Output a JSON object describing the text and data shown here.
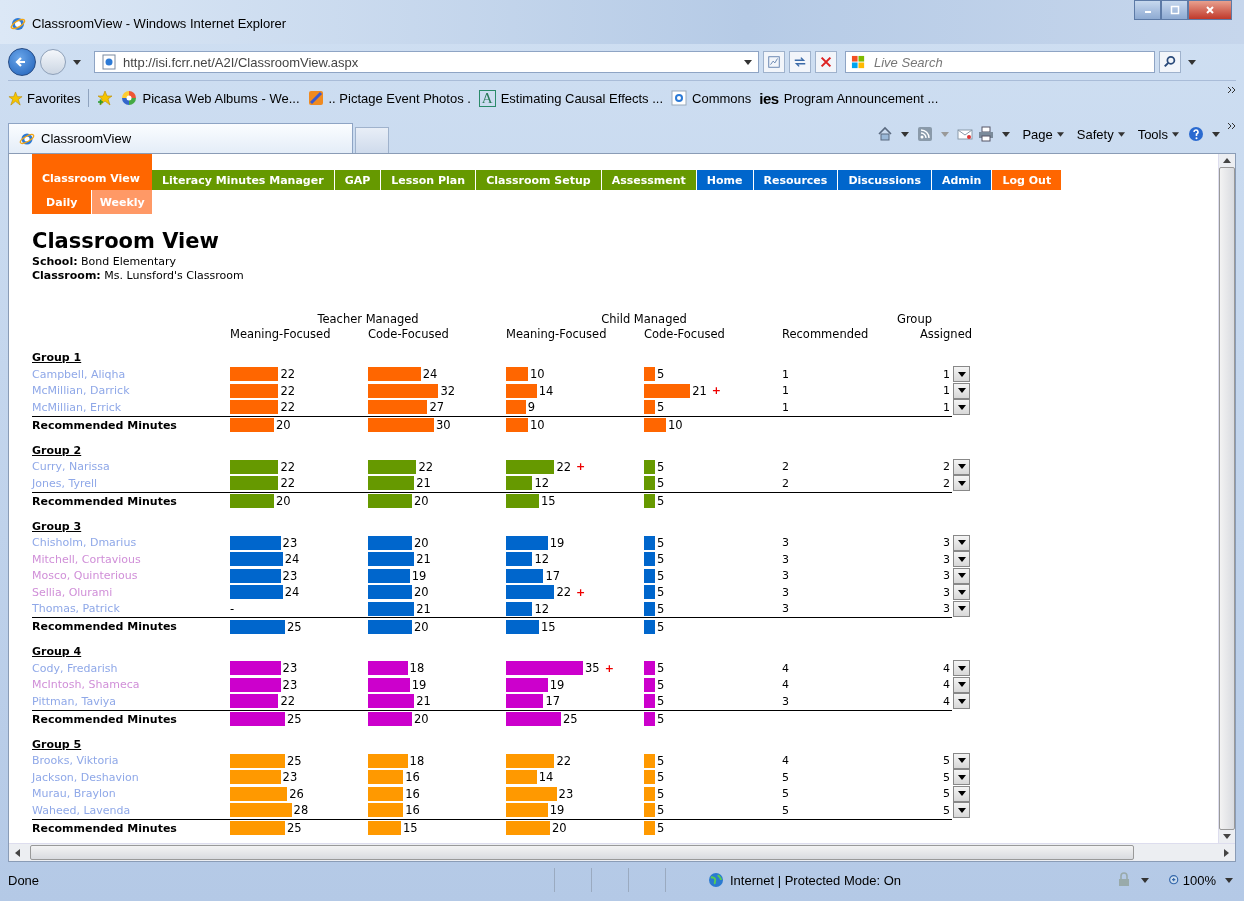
{
  "window": {
    "title": "ClassroomView - Windows Internet Explorer"
  },
  "address_bar": {
    "url": "http://isi.fcrr.net/A2I/ClassroomView.aspx"
  },
  "search": {
    "placeholder": "Live Search"
  },
  "favorites_bar": {
    "label": "Favorites",
    "items": [
      {
        "label": "Picasa Web Albums - We..."
      },
      {
        "label": ".. Pictage  Event Photos ."
      },
      {
        "label": "Estimating Causal Effects ...",
        "icon_text": "A"
      },
      {
        "label": "Commons"
      },
      {
        "label": "Program Announcement ...",
        "icon_text": "ies"
      }
    ]
  },
  "browser_tab": {
    "title": "ClassroomView"
  },
  "command_bar": [
    "Page",
    "Safety",
    "Tools"
  ],
  "nav": {
    "tabs": [
      {
        "label": "Classroom View",
        "color": "#ff6600",
        "selected": true
      },
      {
        "label": "Literacy Minutes Manager",
        "color": "#669900",
        "selected": false
      },
      {
        "label": "GAP",
        "color": "#669900",
        "selected": false
      },
      {
        "label": "Lesson Plan",
        "color": "#669900",
        "selected": false
      },
      {
        "label": "Classroom Setup",
        "color": "#669900",
        "selected": false
      },
      {
        "label": "Assessment",
        "color": "#669900",
        "selected": false
      },
      {
        "label": "Home",
        "color": "#0066cc",
        "selected": false
      },
      {
        "label": "Resources",
        "color": "#0066cc",
        "selected": false
      },
      {
        "label": "Discussions",
        "color": "#0066cc",
        "selected": false
      },
      {
        "label": "Admin",
        "color": "#0066cc",
        "selected": false
      },
      {
        "label": "Log Out",
        "color": "#ff6600",
        "selected": false
      }
    ],
    "subtabs": [
      {
        "label": "Daily",
        "selected": true
      },
      {
        "label": "Weekly",
        "selected": false
      }
    ]
  },
  "page": {
    "title": "Classroom View",
    "school_label": "School:",
    "school": "Bond Elementary",
    "classroom_label": "Classroom:",
    "classroom": "Ms. Lunsford's Classroom"
  },
  "table": {
    "header_groups": [
      "Teacher Managed",
      "Child Managed",
      "Group"
    ],
    "columns": [
      "Meaning-Focused",
      "Code-Focused",
      "Meaning-Focused",
      "Code-Focused",
      "Recommended",
      "Assigned"
    ],
    "groups": [
      {
        "name": "Group 1",
        "color": "#ff6600",
        "students": [
          {
            "name": "Campbell, Aliqha",
            "color": "#8fa8e8",
            "minutes": [
              {
                "value": "22"
              },
              {
                "value": "24"
              },
              {
                "value": "10"
              },
              {
                "value": "5"
              }
            ],
            "recommended": "1",
            "assigned": "1"
          },
          {
            "name": "McMillian, Darrick",
            "color": "#8fa8e8",
            "minutes": [
              {
                "value": "22"
              },
              {
                "value": "32"
              },
              {
                "value": "14"
              },
              {
                "value": "21",
                "flag": "+"
              }
            ],
            "recommended": "1",
            "assigned": "1"
          },
          {
            "name": "McMillian, Errick",
            "color": "#8fa8e8",
            "minutes": [
              {
                "value": "22"
              },
              {
                "value": "27"
              },
              {
                "value": "9"
              },
              {
                "value": "5"
              }
            ],
            "recommended": "1",
            "assigned": "1"
          }
        ],
        "recommended_minutes": {
          "label": "Recommended Minutes",
          "minutes": [
            {
              "value": "20"
            },
            {
              "value": "30"
            },
            {
              "value": "10"
            },
            {
              "value": "10"
            }
          ]
        }
      },
      {
        "name": "Group 2",
        "color": "#669900",
        "students": [
          {
            "name": "Curry, Narissa",
            "color": "#8fa8e8",
            "minutes": [
              {
                "value": "22"
              },
              {
                "value": "22"
              },
              {
                "value": "22",
                "flag": "+"
              },
              {
                "value": "5"
              }
            ],
            "recommended": "2",
            "assigned": "2"
          },
          {
            "name": "Jones, Tyrell",
            "color": "#8fa8e8",
            "minutes": [
              {
                "value": "22"
              },
              {
                "value": "21"
              },
              {
                "value": "12"
              },
              {
                "value": "5"
              }
            ],
            "recommended": "2",
            "assigned": "2"
          }
        ],
        "recommended_minutes": {
          "label": "Recommended Minutes",
          "minutes": [
            {
              "value": "20"
            },
            {
              "value": "20"
            },
            {
              "value": "15"
            },
            {
              "value": "5"
            }
          ]
        }
      },
      {
        "name": "Group 3",
        "color": "#0066cc",
        "students": [
          {
            "name": "Chisholm, Dmarius",
            "color": "#8fa8e8",
            "minutes": [
              {
                "value": "23"
              },
              {
                "value": "20"
              },
              {
                "value": "19"
              },
              {
                "value": "5"
              }
            ],
            "recommended": "3",
            "assigned": "3"
          },
          {
            "name": "Mitchell, Cortavious",
            "color": "#d08fd8",
            "minutes": [
              {
                "value": "24"
              },
              {
                "value": "21"
              },
              {
                "value": "12"
              },
              {
                "value": "5"
              }
            ],
            "recommended": "3",
            "assigned": "3"
          },
          {
            "name": "Mosco, Quinterious",
            "color": "#d08fd8",
            "minutes": [
              {
                "value": "23"
              },
              {
                "value": "19"
              },
              {
                "value": "17"
              },
              {
                "value": "5"
              }
            ],
            "recommended": "3",
            "assigned": "3"
          },
          {
            "name": "Sellia, Olurami",
            "color": "#d08fd8",
            "minutes": [
              {
                "value": "24"
              },
              {
                "value": "20"
              },
              {
                "value": "22",
                "flag": "+"
              },
              {
                "value": "5"
              }
            ],
            "recommended": "3",
            "assigned": "3"
          },
          {
            "name": "Thomas, Patrick",
            "color": "#8fa8e8",
            "minutes": [
              {
                "value": "-"
              },
              {
                "value": "21"
              },
              {
                "value": "12"
              },
              {
                "value": "5"
              }
            ],
            "recommended": "3",
            "assigned": "3"
          }
        ],
        "recommended_minutes": {
          "label": "Recommended Minutes",
          "minutes": [
            {
              "value": "25"
            },
            {
              "value": "20"
            },
            {
              "value": "15"
            },
            {
              "value": "5"
            }
          ]
        }
      },
      {
        "name": "Group 4",
        "color": "#cc00cc",
        "students": [
          {
            "name": "Cody, Fredarish",
            "color": "#8fa8e8",
            "minutes": [
              {
                "value": "23"
              },
              {
                "value": "18"
              },
              {
                "value": "35",
                "flag": "+"
              },
              {
                "value": "5"
              }
            ],
            "recommended": "4",
            "assigned": "4"
          },
          {
            "name": "McIntosh, Shameca",
            "color": "#d08fd8",
            "minutes": [
              {
                "value": "23"
              },
              {
                "value": "19"
              },
              {
                "value": "19"
              },
              {
                "value": "5"
              }
            ],
            "recommended": "4",
            "assigned": "4"
          },
          {
            "name": "Pittman, Taviya",
            "color": "#8fa8e8",
            "minutes": [
              {
                "value": "22"
              },
              {
                "value": "21"
              },
              {
                "value": "17"
              },
              {
                "value": "5"
              }
            ],
            "recommended": "3",
            "assigned": "4"
          }
        ],
        "recommended_minutes": {
          "label": "Recommended Minutes",
          "minutes": [
            {
              "value": "25"
            },
            {
              "value": "20"
            },
            {
              "value": "25"
            },
            {
              "value": "5"
            }
          ]
        }
      },
      {
        "name": "Group 5",
        "color": "#ff9900",
        "students": [
          {
            "name": "Brooks, Viktoria",
            "color": "#8fa8e8",
            "minutes": [
              {
                "value": "25"
              },
              {
                "value": "18"
              },
              {
                "value": "22"
              },
              {
                "value": "5"
              }
            ],
            "recommended": "4",
            "assigned": "5"
          },
          {
            "name": "Jackson, Deshavion",
            "color": "#8fa8e8",
            "minutes": [
              {
                "value": "23"
              },
              {
                "value": "16"
              },
              {
                "value": "14"
              },
              {
                "value": "5"
              }
            ],
            "recommended": "5",
            "assigned": "5"
          },
          {
            "name": "Murau, Braylon",
            "color": "#8fa8e8",
            "minutes": [
              {
                "value": "26"
              },
              {
                "value": "16"
              },
              {
                "value": "23"
              },
              {
                "value": "5"
              }
            ],
            "recommended": "5",
            "assigned": "5"
          },
          {
            "name": "Waheed, Lavenda",
            "color": "#8fa8e8",
            "minutes": [
              {
                "value": "28"
              },
              {
                "value": "16"
              },
              {
                "value": "19"
              },
              {
                "value": "5"
              }
            ],
            "recommended": "5",
            "assigned": "5"
          }
        ],
        "recommended_minutes": {
          "label": "Recommended Minutes",
          "minutes": [
            {
              "value": "25"
            },
            {
              "value": "15"
            },
            {
              "value": "20"
            },
            {
              "value": "5"
            }
          ]
        }
      }
    ]
  },
  "status_bar": {
    "status": "Done",
    "zone": "Internet | Protected Mode: On",
    "zoom": "100%"
  }
}
